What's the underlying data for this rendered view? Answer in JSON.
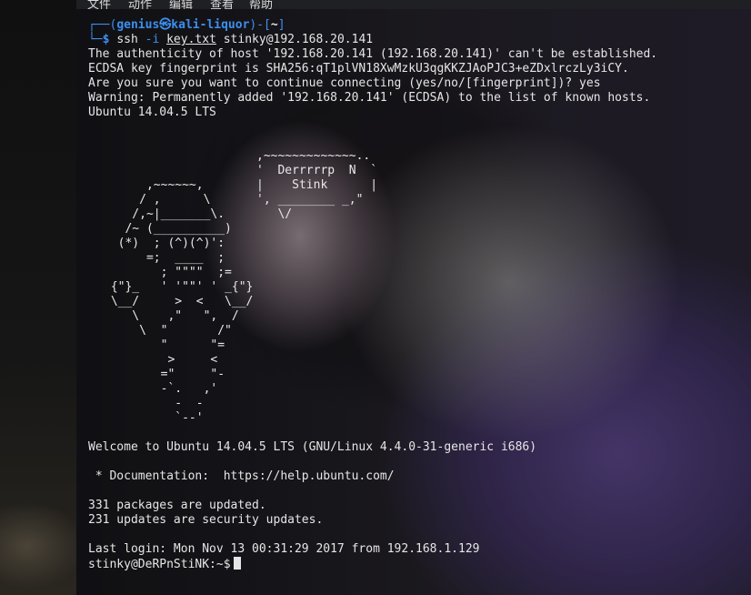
{
  "menubar": {
    "items": [
      "文件",
      "动作",
      "编辑",
      "查看",
      "帮助"
    ]
  },
  "prompt": {
    "corner_top": "┌──(",
    "user": "genius",
    "at": "㉿",
    "host": "kali-liquor",
    "mid": ")-[",
    "dir": "~",
    "end": "]",
    "corner_bottom": "└─",
    "symbol": "$"
  },
  "command": {
    "name": "ssh",
    "flag": "-i",
    "keyfile": "key.txt",
    "target": "stinky@192.168.20.141"
  },
  "output": {
    "authenticity": "The authenticity of host '192.168.20.141 (192.168.20.141)' can't be established.",
    "fingerprint": "ECDSA key fingerprint is SHA256:qT1plVN18XwMzkU3qgKKZJAoPJC3+eZDxlrczLy3iCY.",
    "confirm": "Are you sure you want to continue connecting (yes/no/[fingerprint])? yes",
    "warning": "Warning: Permanently added '192.168.20.141' (ECDSA) to the list of known hosts.",
    "os": "Ubuntu 14.04.5 LTS",
    "welcome": "Welcome to Ubuntu 14.04.5 LTS (GNU/Linux 4.4.0-31-generic i686)",
    "documentation": " * Documentation:  https://help.ubuntu.com/",
    "packages": "331 packages are updated.",
    "security": "231 updates are security updates.",
    "last_login": "Last login: Mon Nov 13 00:31:29 2017 from 192.168.1.129",
    "remote_prompt": "stinky@DeRPnStiNK:~$"
  },
  "ascii_bubble": [
    ",~~~~~~~~~~~~~..",
    "'  Derrrrrp  N  `",
    "|    Stink      |",
    "', ________ _,\"",
    "   \\/"
  ],
  "ascii_figure": [
    "      ,~~~~~~,",
    "     / ,      \\",
    "    /,~|_______\\.",
    "   /~ (__________)",
    "  (*)  ; (^)(^)':",
    "      =;  ____  ;",
    "        ; \"\"\"\"  ;=",
    " {\"}_   ' '\"\"' ' _{\"}",
    " \\__/     >  <   \\__/",
    "    \\    ,\"   \",  /",
    "     \\  \"       /\"",
    "        \"      \"=",
    "         >     <",
    "        =\"     \"-",
    "        -`.   ,'",
    "          -  -",
    "          `--'"
  ]
}
